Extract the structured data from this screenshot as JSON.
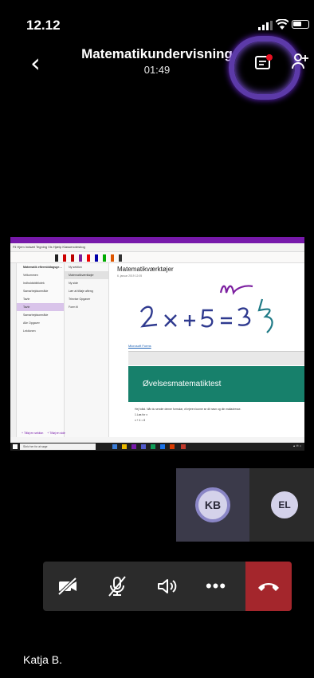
{
  "status_bar": {
    "time": "12.12"
  },
  "header": {
    "title": "Matematikundervisning",
    "duration": "01:49"
  },
  "shared_screen": {
    "ribbon_tabs": "Fil  Hjem  Indsæt  Tegning  Vis  Hjælp  Klassenotesbog",
    "notebook_header": "Matematik eftermiddagsge…",
    "notebook_sections": [
      "Velkommen",
      "Indholdsbibliotek",
      "Samarbejdsområde",
      "Tavle",
      "Tavle",
      "Samarbejdsområde",
      "Alle Opgaver",
      "Lektionen"
    ],
    "pages": [
      "Ny sektion",
      "Matematikværktøjer",
      "Ny side",
      "Lær at tilføje afleng",
      "Trinvise Opgaver",
      "Form til"
    ],
    "page_title": "Matematikværktøjer",
    "page_date": "6. januar 2019    12:05",
    "link_text": "Microsoft Forms",
    "embed_title": "Øvelsesmatematiktest",
    "embed_text": "Hej folkd. Når du sender denne formular, vil ejeren kunne se dit navn og din mailadresse.",
    "embed_item1": "1.Løs for x",
    "embed_item2": "x + 4 = 8",
    "add_section": "+ Tilføj en sektion",
    "add_page": "+ Tilføj en side",
    "search_placeholder": "Skriv her for at søge"
  },
  "participants": [
    {
      "initials": "KB"
    },
    {
      "initials": "EL"
    }
  ],
  "self_name": "Katja B.",
  "icons": {
    "camera": "camera-off-icon",
    "mic": "mic-off-icon",
    "speaker": "speaker-icon",
    "more": "more-icon",
    "hangup": "hang-up-icon",
    "chat": "chat-icon"
  },
  "colors": {
    "accent": "#7719aa",
    "hangup": "#a4262c",
    "forms_green": "#17806b",
    "avatar": "#d4d2ea"
  }
}
